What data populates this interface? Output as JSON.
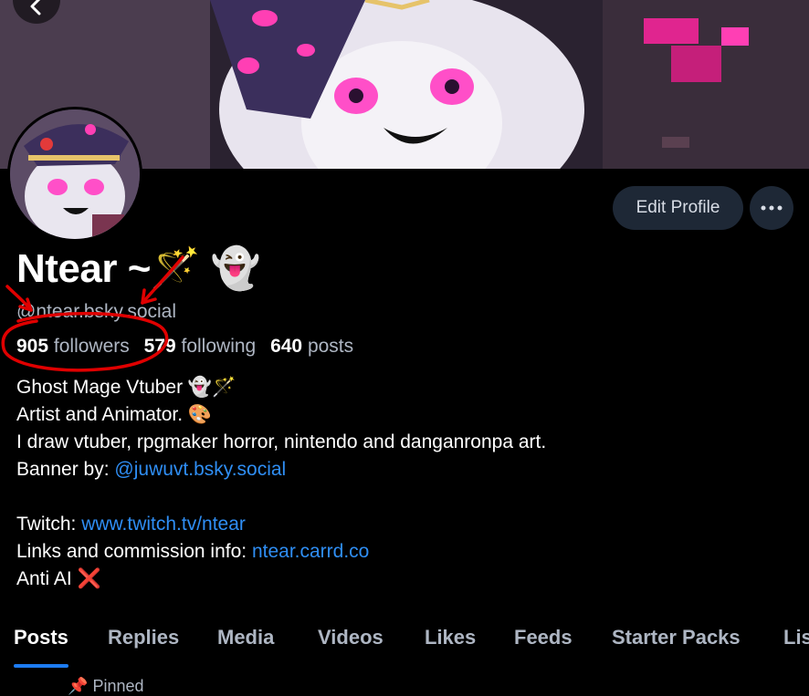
{
  "profile": {
    "display_name": "Ntear ~🪄 👻",
    "handle": "@ntear.bsky.social",
    "followers_count": "905",
    "followers_label": "followers",
    "following_count": "579",
    "following_label": "following",
    "posts_count": "640",
    "posts_label": "posts"
  },
  "actions": {
    "edit_profile_label": "Edit Profile",
    "more_icon": "ellipsis-icon",
    "back_icon": "chevron-left-icon"
  },
  "bio": {
    "line1": "Ghost Mage Vtuber 👻🪄",
    "line2": "Artist and Animator. 🎨",
    "line3": "I draw vtuber, rpgmaker horror, nintendo and danganronpa art.",
    "line4_prefix": "Banner by: ",
    "line4_link": "@juwuvt.bsky.social",
    "line6_prefix": "Twitch: ",
    "line6_link": "www.twitch.tv/ntear",
    "line7_prefix": "Links and commission info: ",
    "line7_link": "ntear.carrd.co",
    "line8": "Anti AI ❌"
  },
  "tabs": [
    {
      "label": "Posts",
      "active": true
    },
    {
      "label": "Replies"
    },
    {
      "label": "Media"
    },
    {
      "label": "Videos"
    },
    {
      "label": "Likes"
    },
    {
      "label": "Feeds"
    },
    {
      "label": "Starter Packs"
    },
    {
      "label": "Lis"
    }
  ],
  "pinned_label": "Pinned",
  "colors": {
    "background": "#000000",
    "link": "#2f8ef4",
    "muted_text": "#aeb6c3",
    "button_bg": "#1e2836",
    "tab_indicator": "#1d7cf2",
    "annotation_red": "#e00000"
  }
}
